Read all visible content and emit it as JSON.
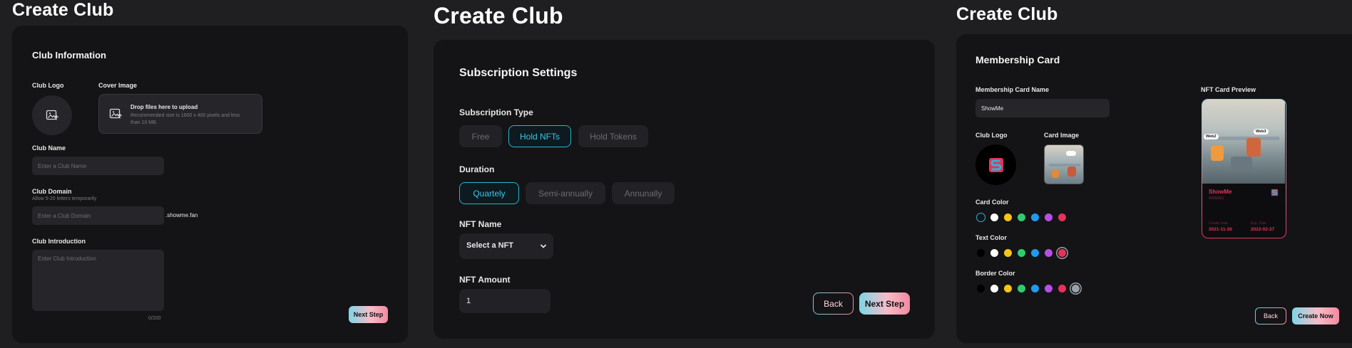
{
  "panel1": {
    "title": "Create Club",
    "section": "Club Information",
    "logo_label": "Club Logo",
    "cover_label": "Cover Image",
    "drop_title": "Drop files here to upload",
    "drop_hint": "Recommended size is 1600 x 400 pixels and less than 10 MB.",
    "name_label": "Club Name",
    "name_placeholder": "Enter a Club Name",
    "domain_label": "Club Domain",
    "domain_hint": "Allow 5-20 letters temporarily",
    "domain_placeholder": "Enter a Club Domain",
    "domain_suffix": ".showme.fan",
    "intro_label": "Club Introduction",
    "intro_placeholder": "Enter Club Introduction",
    "intro_count": "0/200",
    "next_label": "Next Step"
  },
  "panel2": {
    "title": "Create Club",
    "section": "Subscription Settings",
    "type_label": "Subscription Type",
    "types": [
      "Free",
      "Hold NFTs",
      "Hold Tokens"
    ],
    "duration_label": "Duration",
    "durations": [
      "Quartely",
      "Semi-annually",
      "Annunally"
    ],
    "nft_name_label": "NFT Name",
    "nft_select": "Select a NFT",
    "nft_amount_label": "NFT Amount",
    "nft_amount_value": "1",
    "back_label": "Back",
    "next_label": "Next Step"
  },
  "panel3": {
    "title": "Create Club",
    "section": "Membership Card",
    "card_name_label": "Membership Card Name",
    "card_name_value": "ShowMe",
    "preview_label": "NFT Card Preview",
    "logo_label": "Club Logo",
    "image_label": "Card Image",
    "card_color_label": "Card Color",
    "text_color_label": "Text Color",
    "border_color_label": "Border Color",
    "preview": {
      "name": "ShowMe",
      "sub": "#000001",
      "create_label": "Create Date",
      "create_value": "2021-11-26",
      "exp_label": "Exp. Date",
      "exp_value": "2022-02-27",
      "bubble_left": "Web2",
      "bubble_right": "Web3"
    },
    "back_label": "Back",
    "create_label": "Create Now"
  },
  "colors": {
    "accent_cyan": "#2bb4cf",
    "accent_pink": "#e8315a",
    "swatches": [
      "#000000",
      "#ffffff",
      "#f5c518",
      "#2ecc71",
      "#1e9bf0",
      "#b84ee6",
      "#e8315a",
      "#9aa2a8"
    ]
  }
}
